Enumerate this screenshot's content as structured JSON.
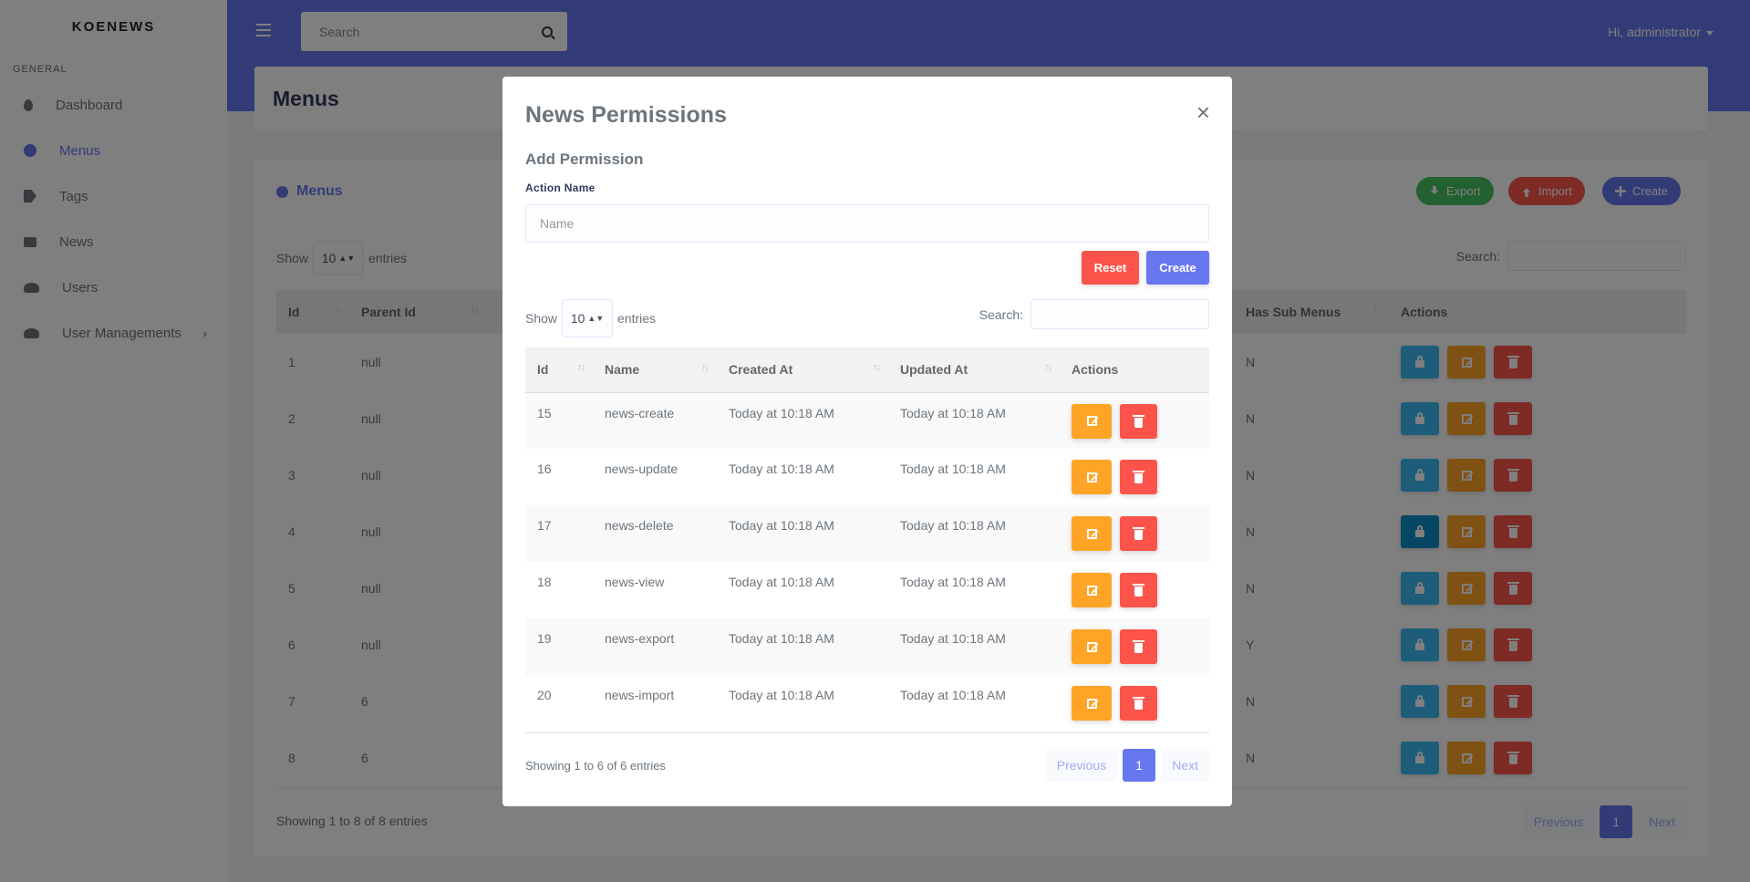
{
  "sidebar": {
    "brand": "KOENEWS",
    "section": "GENERAL",
    "items": [
      {
        "label": "Dashboard"
      },
      {
        "label": "Menus"
      },
      {
        "label": "Tags"
      },
      {
        "label": "News"
      },
      {
        "label": "Users"
      },
      {
        "label": "User Managements"
      }
    ],
    "active_color": "#6777ef"
  },
  "navbar": {
    "search_placeholder": "Search",
    "user": "Hi, administrator",
    "color": "#6777ef"
  },
  "page": {
    "title": "Menus",
    "card_title": "Menus",
    "buttons": {
      "export": "Export",
      "import": "Import",
      "create": "Create"
    },
    "show_label": "Show",
    "entries_label": "entries",
    "entries_value": "10",
    "search_label": "Search:",
    "columns": [
      "Id",
      "Parent Id",
      "Has Sub Menus",
      "Actions"
    ],
    "rows": [
      {
        "id": "1",
        "parent": "null",
        "has_sub": "N"
      },
      {
        "id": "2",
        "parent": "null",
        "has_sub": "N"
      },
      {
        "id": "3",
        "parent": "null",
        "has_sub": "N"
      },
      {
        "id": "4",
        "parent": "null",
        "has_sub": "N"
      },
      {
        "id": "5",
        "parent": "null",
        "has_sub": "N"
      },
      {
        "id": "6",
        "parent": "null",
        "has_sub": "Y"
      },
      {
        "id": "7",
        "parent": "6",
        "has_sub": "N"
      },
      {
        "id": "8",
        "parent": "6",
        "has_sub": "N"
      }
    ],
    "footer": "Showing 1 to 8 of 8 entries",
    "pager": {
      "previous": "Previous",
      "page": "1",
      "next": "Next"
    }
  },
  "modal": {
    "title": "News Permissions",
    "close": "×",
    "subtitle": "Add Permission",
    "field_label": "Action Name",
    "field_placeholder": "Name",
    "reset": "Reset",
    "create": "Create",
    "show_label": "Show",
    "entries_value": "10",
    "entries_label": "entries",
    "search_label": "Search:",
    "columns": [
      "Id",
      "Name",
      "Created At",
      "Updated At",
      "Actions"
    ],
    "rows": [
      {
        "id": "15",
        "name": "news-create",
        "created": "Today at 10:18 AM",
        "updated": "Today at 10:18 AM"
      },
      {
        "id": "16",
        "name": "news-update",
        "created": "Today at 10:18 AM",
        "updated": "Today at 10:18 AM"
      },
      {
        "id": "17",
        "name": "news-delete",
        "created": "Today at 10:18 AM",
        "updated": "Today at 10:18 AM"
      },
      {
        "id": "18",
        "name": "news-view",
        "created": "Today at 10:18 AM",
        "updated": "Today at 10:18 AM"
      },
      {
        "id": "19",
        "name": "news-export",
        "created": "Today at 10:18 AM",
        "updated": "Today at 10:18 AM"
      },
      {
        "id": "20",
        "name": "news-import",
        "created": "Today at 10:18 AM",
        "updated": "Today at 10:18 AM"
      }
    ],
    "footer": "Showing 1 to 6 of 6 entries",
    "pager": {
      "previous": "Previous",
      "page": "1",
      "next": "Next"
    }
  }
}
